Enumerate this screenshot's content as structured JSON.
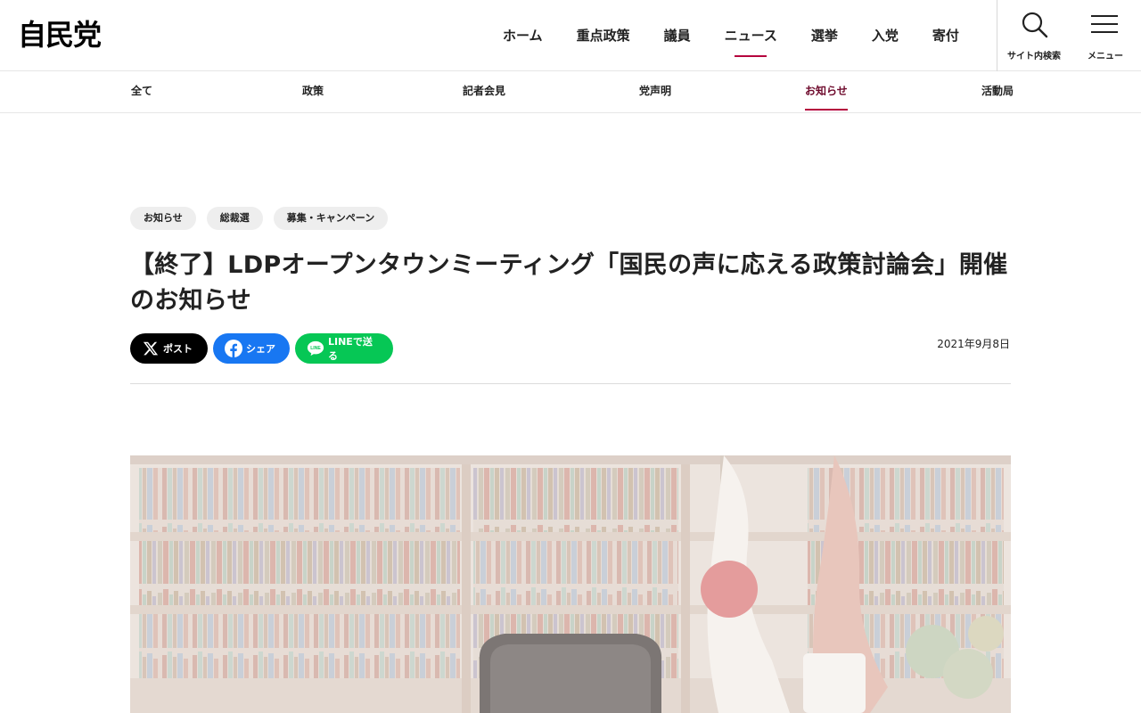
{
  "header": {
    "logo": "自民党",
    "nav": [
      {
        "label": "ホーム",
        "active": false
      },
      {
        "label": "重点政策",
        "active": false
      },
      {
        "label": "議員",
        "active": false
      },
      {
        "label": "ニュース",
        "active": true
      },
      {
        "label": "選挙",
        "active": false
      },
      {
        "label": "入党",
        "active": false
      },
      {
        "label": "寄付",
        "active": false
      }
    ],
    "search_label": "サイト内検索",
    "menu_label": "メニュー"
  },
  "sub_nav": [
    {
      "label": "全て",
      "active": false
    },
    {
      "label": "政策",
      "active": false
    },
    {
      "label": "記者会見",
      "active": false
    },
    {
      "label": "党声明",
      "active": false
    },
    {
      "label": "お知らせ",
      "active": true
    },
    {
      "label": "活動局",
      "active": false
    }
  ],
  "article": {
    "tags": [
      "お知らせ",
      "総裁選",
      "募集・キャンペーン"
    ],
    "title": "【終了】LDPオープンタウンミーティング「国民の声に応える政策討論会」開催のお知らせ",
    "share": {
      "x": "ポスト",
      "facebook": "シェア",
      "line": "LINEで送る",
      "line_icon_text": "LINE"
    },
    "date": "2021年9月8日"
  },
  "colors": {
    "accent": "#b5003d",
    "active_text": "#6e0a2c",
    "x": "#000000",
    "facebook": "#1877f2",
    "line": "#06c755"
  }
}
